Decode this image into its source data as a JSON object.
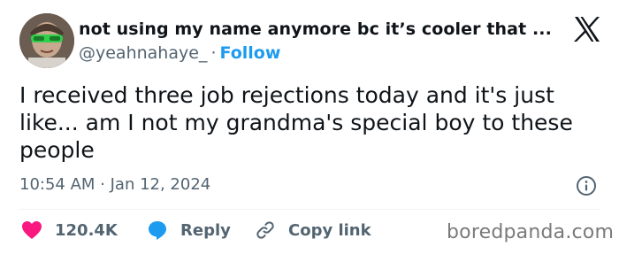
{
  "author": {
    "display_name": "not using my name anymore bc it’s cooler that ...",
    "handle": "@yeahnahaye_",
    "separator": "·",
    "follow_label": "Follow"
  },
  "tweet": {
    "lines": [
      "I received three job rejections today and it's just",
      "like... am I not my grandma's special boy to these",
      "people"
    ],
    "timestamp": "10:54 AM · Jan 12, 2024"
  },
  "actions": {
    "likes_count": "120.4K",
    "reply_label": "Reply",
    "copy_link_label": "Copy link"
  },
  "watermark": "boredpanda.com",
  "colors": {
    "text": "#0f1419",
    "muted": "#536471",
    "accent": "#1d9bf0",
    "like": "#f91880"
  },
  "icons": {
    "logo": "x-logo-icon",
    "info": "info-icon",
    "like": "heart-icon",
    "reply": "speech-bubble-icon",
    "copy": "link-icon"
  }
}
